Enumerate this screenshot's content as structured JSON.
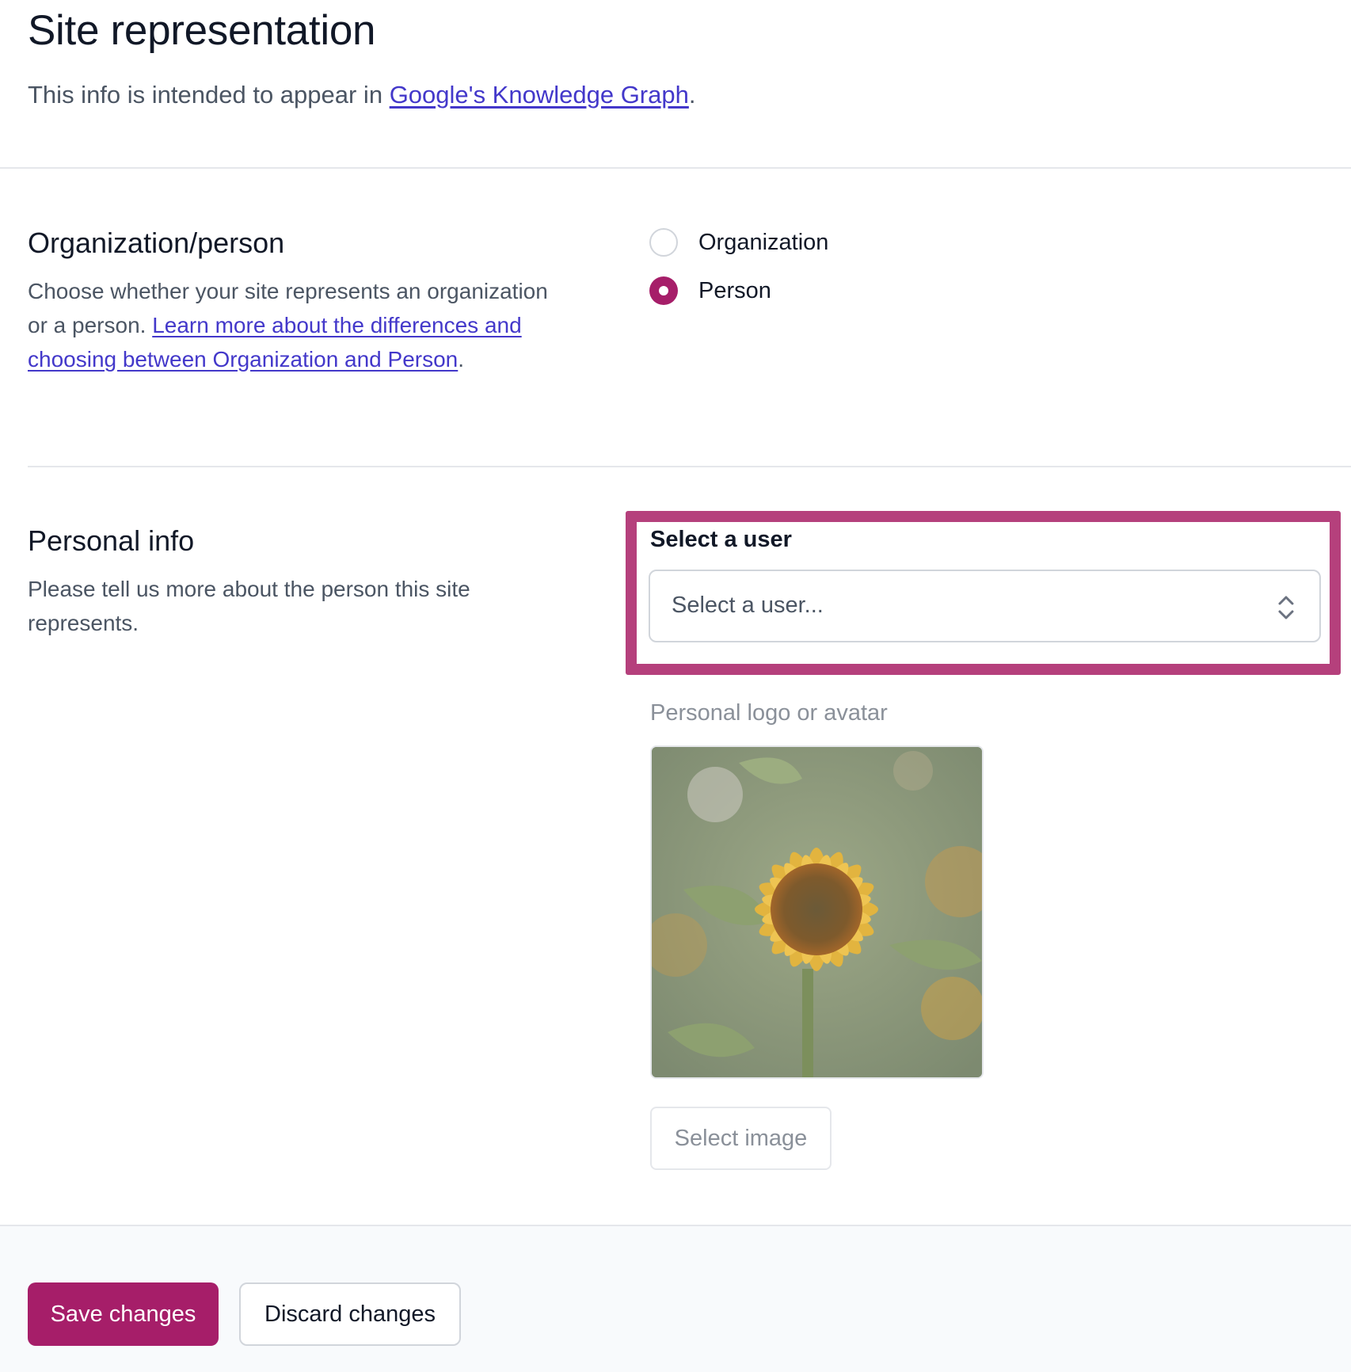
{
  "header": {
    "title": "Site representation",
    "intro_text": "This info is intended to appear in ",
    "intro_link": "Google's Knowledge Graph",
    "intro_end": "."
  },
  "org_person": {
    "title": "Organization/person",
    "desc_text": "Choose whether your site represents an organization or a person. ",
    "desc_link": "Learn more about the differences and choosing between Organization and Person",
    "desc_end": ".",
    "options": [
      {
        "label": "Organization",
        "checked": false
      },
      {
        "label": "Person",
        "checked": true
      }
    ]
  },
  "personal_info": {
    "title": "Personal info",
    "desc": "Please tell us more about the person this site represents.",
    "user_field": {
      "label": "Select a user",
      "placeholder": "Select a user..."
    },
    "avatar": {
      "label": "Personal logo or avatar",
      "image": "sunflower"
    },
    "select_image_label": "Select image"
  },
  "footer": {
    "save_label": "Save changes",
    "discard_label": "Discard changes"
  },
  "colors": {
    "accent": "#a61e69",
    "highlight_border": "#b5407c",
    "link": "#4338ca"
  },
  "icons": {
    "select_chevrons": "chevron-up-down-icon"
  }
}
